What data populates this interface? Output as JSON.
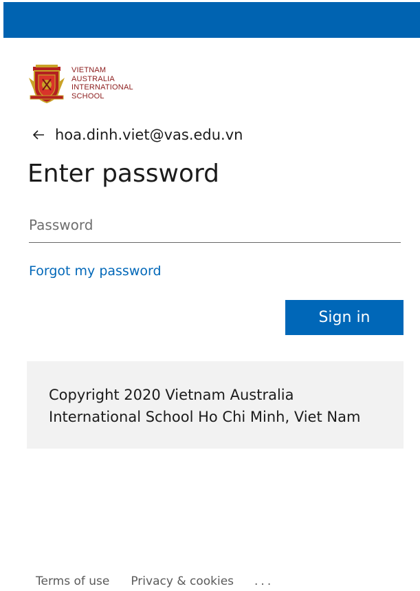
{
  "logo": {
    "lines": [
      "VIETNAM",
      "AUSTRALIA",
      "INTERNATIONAL",
      "SCHOOL"
    ]
  },
  "identity": {
    "email": "hoa.dinh.viet@vas.edu.vn"
  },
  "heading": "Enter password",
  "password": {
    "placeholder": "Password",
    "value": ""
  },
  "forgot_link": "Forgot my password",
  "signin_button": "Sign in",
  "copyright": "Copyright 2020 Vietnam Australia International School Ho Chi Minh, Viet Nam",
  "footer": {
    "terms": "Terms of use",
    "privacy": "Privacy & cookies",
    "more": "..."
  },
  "colors": {
    "brand_bar": "#0063b1",
    "accent": "#0067b8",
    "logo_red": "#8b1a1a"
  }
}
